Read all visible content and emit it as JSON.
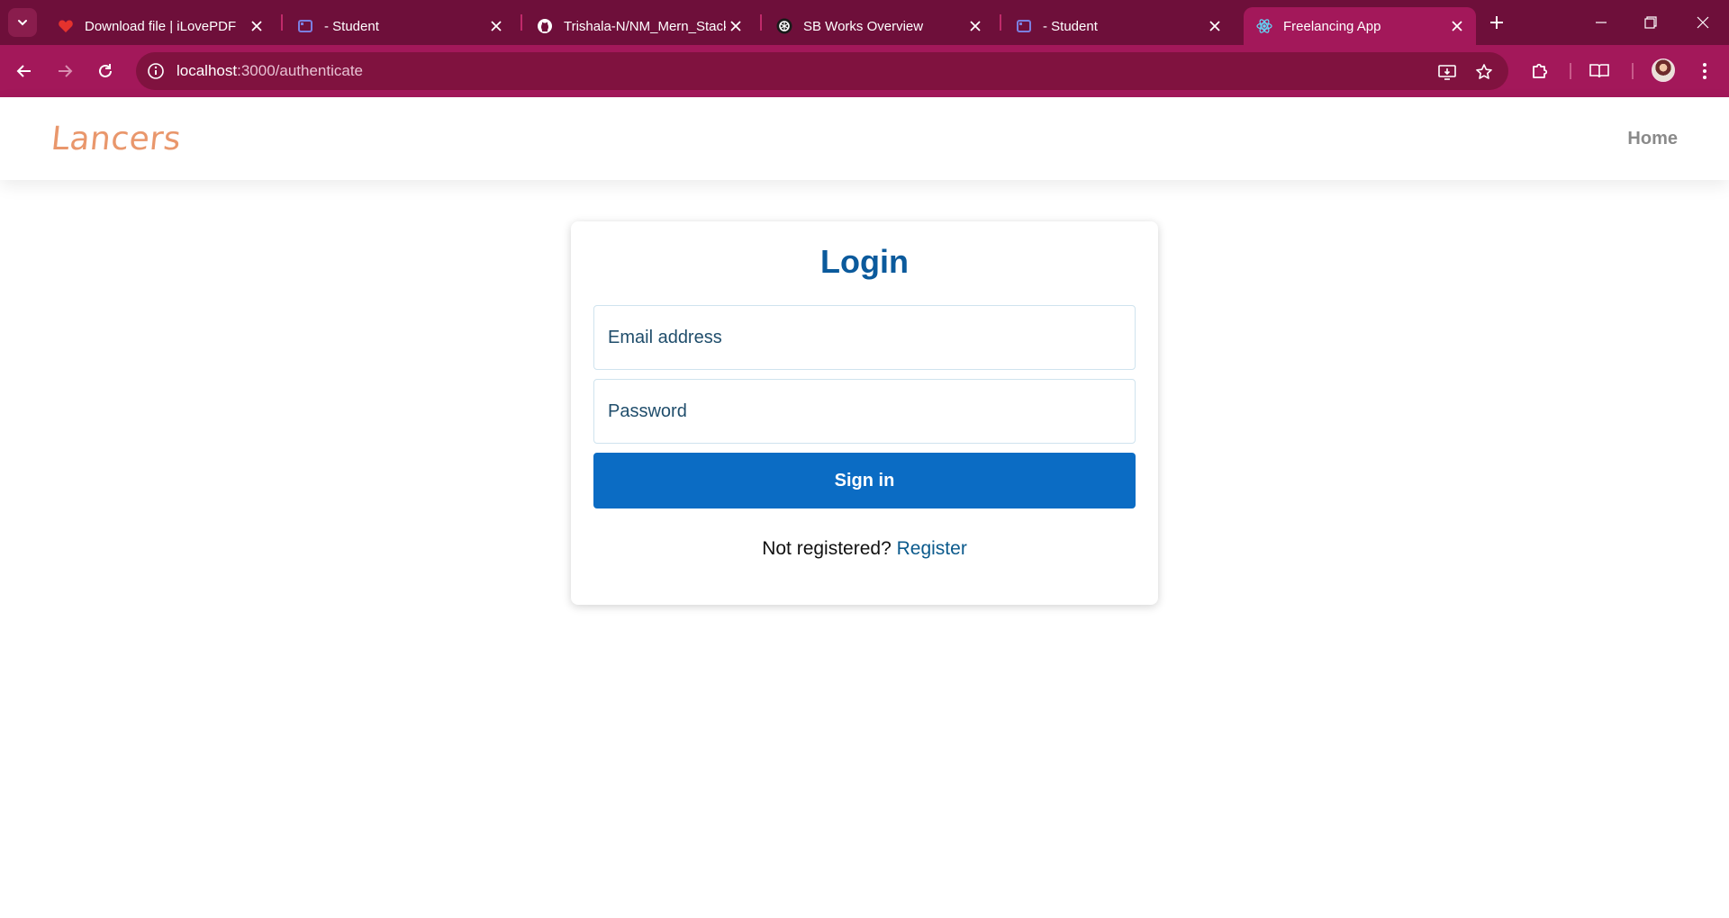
{
  "browser": {
    "tabs": [
      {
        "title": "Download file | iLovePDF",
        "icon": "ilovepdf-heart-icon",
        "active": false
      },
      {
        "title": "- Student",
        "icon": "student-portal-icon",
        "active": false
      },
      {
        "title": "Trishala-N/NM_Mern_Stack",
        "icon": "github-icon",
        "active": false
      },
      {
        "title": "SB Works Overview",
        "icon": "openai-icon",
        "active": false
      },
      {
        "title": "- Student",
        "icon": "student-portal-icon",
        "active": false
      },
      {
        "title": "Freelancing App",
        "icon": "react-icon",
        "active": true
      }
    ],
    "url_host": "localhost",
    "url_rest": ":3000/authenticate",
    "colors": {
      "tabbar": "#6e0f3a",
      "toolbar": "#a3185a",
      "omnibox": "#80123f"
    }
  },
  "app": {
    "brand": "Lancers",
    "nav": {
      "home": "Home"
    },
    "login": {
      "title": "Login",
      "email_placeholder": "Email address",
      "password_placeholder": "Password",
      "submit_label": "Sign in",
      "register_prompt": "Not registered?",
      "register_link": "Register"
    },
    "colors": {
      "brand": "#e9976c",
      "primary": "#0b6cc4",
      "title": "#0b5a9c"
    }
  }
}
